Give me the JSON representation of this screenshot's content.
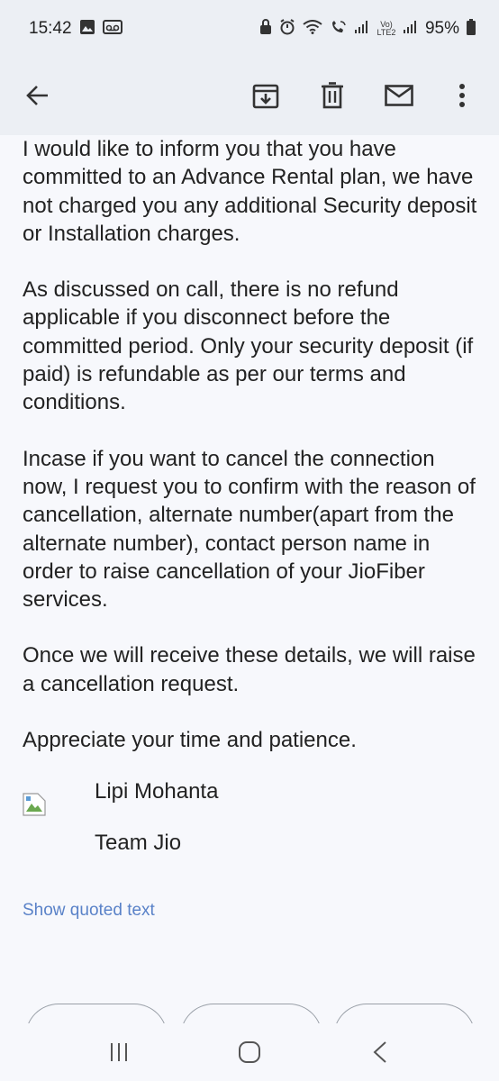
{
  "status_bar": {
    "time": "15:42",
    "battery": "95%",
    "left_icons": [
      "gallery-icon",
      "voicemail-icon"
    ],
    "right_icons": [
      "lock-icon",
      "alarm-icon",
      "wifi-icon",
      "wifi-calling-icon",
      "signal-icon",
      "volte-icon",
      "signal-icon",
      "battery-icon"
    ],
    "volte_label": "Vo) LTE2"
  },
  "toolbar": {
    "icons": [
      "back-arrow-icon",
      "archive-icon",
      "delete-icon",
      "mail-icon",
      "more-vert-icon"
    ]
  },
  "email": {
    "paragraphs": [
      "I would like to inform you that you have committed to an Advance Rental plan, we have not charged you any additional Security deposit or Installation charges.",
      "As discussed on call, there is no refund applicable if you disconnect before the committed period. Only your security deposit (if paid) is refundable as per our terms and conditions.",
      "Incase if you want to cancel the connection now, I request you to confirm with the reason of cancellation, alternate number(apart from the alternate number), contact person name in order to raise cancellation of your JioFiber services.",
      "Once we will receive these details, we will raise a cancellation request.",
      "Appreciate your time and patience."
    ],
    "signature": {
      "name": "Lipi Mohanta",
      "team": "Team Jio"
    },
    "show_quoted": "Show quoted text"
  },
  "nav_bar": {
    "icons": [
      "recents-icon",
      "home-icon",
      "back-icon"
    ]
  },
  "colors": {
    "header_bg": "#eceff4",
    "body_bg": "#f7f8fc",
    "link": "#5a82c8"
  }
}
